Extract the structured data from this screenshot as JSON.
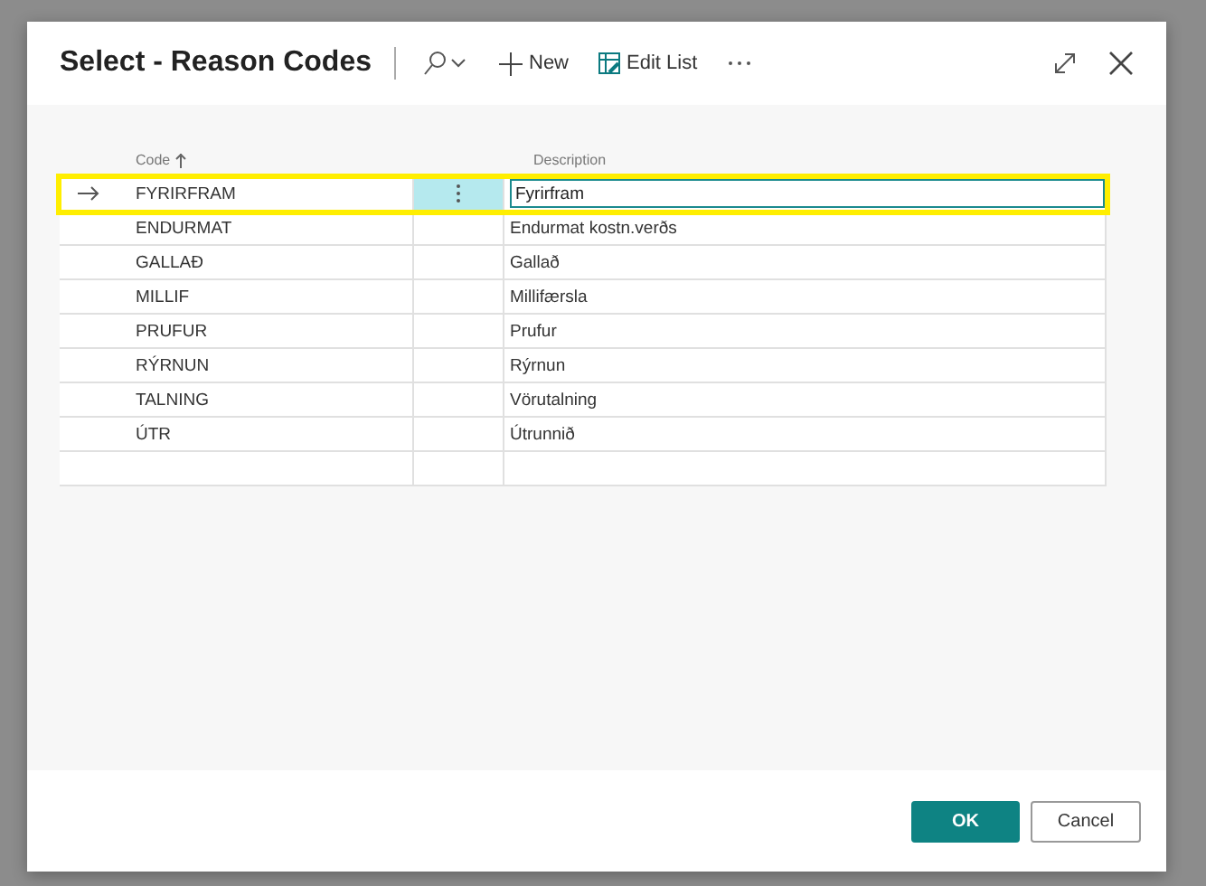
{
  "dialog": {
    "title": "Select - Reason Codes",
    "actions": [
      {
        "kind": "search"
      },
      {
        "kind": "new",
        "label": "New"
      },
      {
        "kind": "edit",
        "label": "Edit List"
      },
      {
        "kind": "more"
      }
    ]
  },
  "table": {
    "columns": [
      "Code",
      "Description"
    ],
    "sorted_ascending": true,
    "rows": [
      {
        "code": "FYRIRFRAM",
        "description": "Fyrirfram",
        "selected": true
      },
      {
        "code": "ENDURMAT",
        "description": "Endurmat kostn.verðs",
        "selected": false
      },
      {
        "code": "GALLAÐ",
        "description": "Gallað",
        "selected": false
      },
      {
        "code": "MILLIF",
        "description": "Millifærsla",
        "selected": false
      },
      {
        "code": "PRUFUR",
        "description": "Prufur",
        "selected": false
      },
      {
        "code": "RÝRNUN",
        "description": "Rýrnun",
        "selected": false
      },
      {
        "code": "TALNING",
        "description": "Vörutalning",
        "selected": false
      },
      {
        "code": "ÚTR",
        "description": "Útrunnið",
        "selected": false
      }
    ]
  },
  "buttons": [
    {
      "kind": "primary",
      "label": "OK"
    },
    {
      "kind": "secondary",
      "label": "Cancel"
    }
  ]
}
